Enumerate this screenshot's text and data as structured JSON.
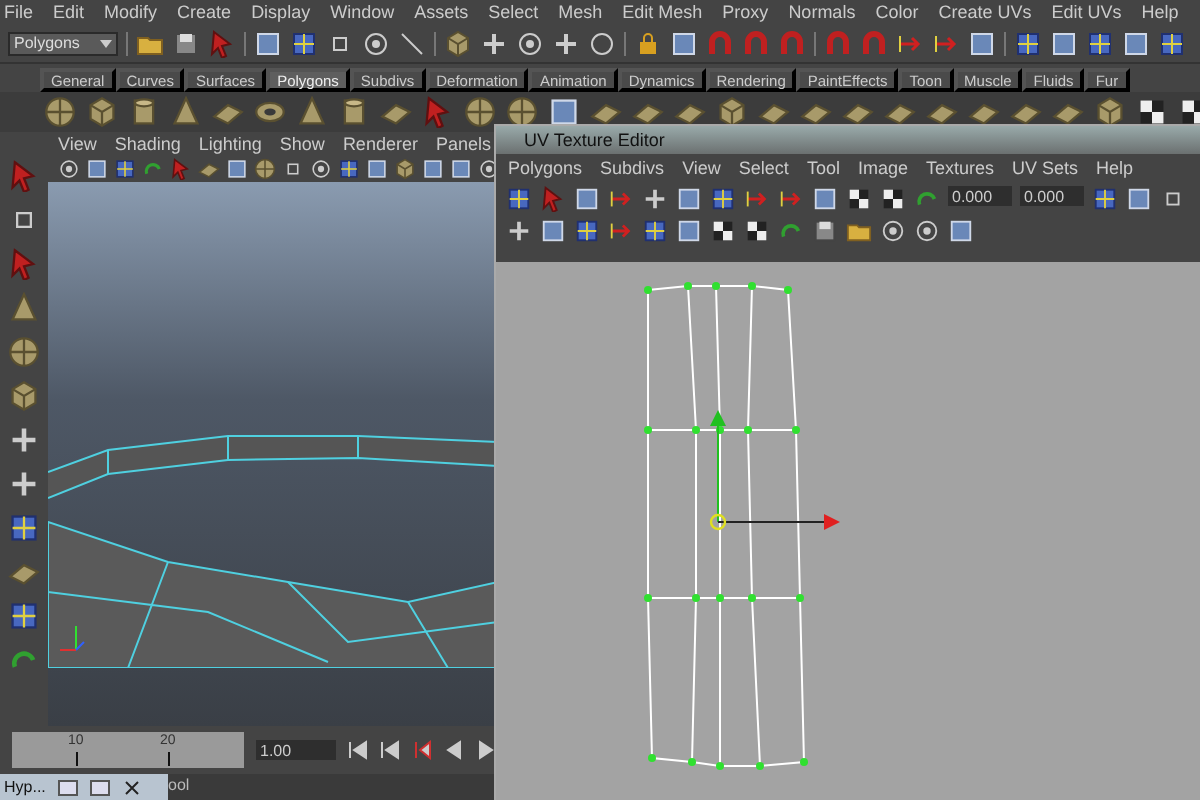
{
  "menubar": [
    "File",
    "Edit",
    "Modify",
    "Create",
    "Display",
    "Window",
    "Assets",
    "Select",
    "Mesh",
    "Edit Mesh",
    "Proxy",
    "Normals",
    "Color",
    "Create UVs",
    "Edit UVs",
    "Help"
  ],
  "toolbar": {
    "mode": "Polygons"
  },
  "shelf": {
    "tabs": [
      {
        "label": "General",
        "selected": false
      },
      {
        "label": "Curves",
        "selected": false
      },
      {
        "label": "Surfaces",
        "selected": false
      },
      {
        "label": "Polygons",
        "selected": true
      },
      {
        "label": "Subdivs",
        "selected": false
      },
      {
        "label": "Deformation",
        "selected": false
      },
      {
        "label": "Animation",
        "selected": false
      },
      {
        "label": "Dynamics",
        "selected": false
      },
      {
        "label": "Rendering",
        "selected": false
      },
      {
        "label": "PaintEffects",
        "selected": false
      },
      {
        "label": "Toon",
        "selected": false
      },
      {
        "label": "Muscle",
        "selected": false
      },
      {
        "label": "Fluids",
        "selected": false
      },
      {
        "label": "Fur",
        "selected": false
      }
    ]
  },
  "viewport": {
    "menu": [
      "View",
      "Shading",
      "Lighting",
      "Show",
      "Renderer",
      "Panels"
    ]
  },
  "uv_editor": {
    "title": "UV Texture Editor",
    "menu": [
      "Polygons",
      "Subdivs",
      "View",
      "Select",
      "Tool",
      "Image",
      "Textures",
      "UV Sets",
      "Help"
    ],
    "fields": [
      "0.000",
      "0.000"
    ]
  },
  "time_slider": {
    "ticks": [
      "10",
      "20"
    ],
    "current_frame": "1.00"
  },
  "help_line": {
    "text": "ool"
  },
  "minimized_window": {
    "title": "Hyp..."
  }
}
